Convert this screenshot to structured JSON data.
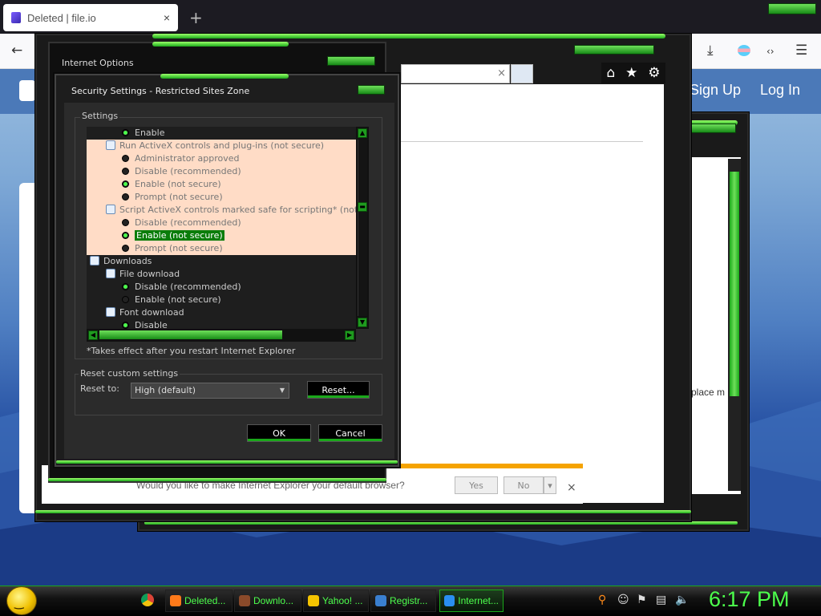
{
  "browser": {
    "tab_title": "Deleted | file.io",
    "new_tab_icon": "+",
    "close_tab_icon": "×"
  },
  "site": {
    "signup": "Sign Up",
    "login": "Log In",
    "partial_text": "place m"
  },
  "ie": {
    "notification": "Would you like to make Internet Explorer your default browser?",
    "yes": "Yes",
    "no": "No"
  },
  "internet_options": {
    "title": "Internet Options"
  },
  "security": {
    "title": "Security Settings - Restricted Sites Zone",
    "settings_label": "Settings",
    "tree": [
      {
        "text": "Enable",
        "type": "radio",
        "on": true,
        "indent": 2,
        "hl": false
      },
      {
        "text": "Run ActiveX controls and plug-ins (not secure)",
        "type": "group",
        "indent": 1,
        "hl": true
      },
      {
        "text": "Administrator approved",
        "type": "radio",
        "on": false,
        "indent": 2,
        "hl": true
      },
      {
        "text": "Disable (recommended)",
        "type": "radio",
        "on": false,
        "indent": 2,
        "hl": true
      },
      {
        "text": "Enable (not secure)",
        "type": "radio",
        "on": true,
        "indent": 2,
        "hl": true
      },
      {
        "text": "Prompt (not secure)",
        "type": "radio",
        "on": false,
        "indent": 2,
        "hl": true
      },
      {
        "text": "Script ActiveX controls marked safe for scripting* (not secure)",
        "type": "group",
        "indent": 1,
        "hl": true
      },
      {
        "text": "Disable (recommended)",
        "type": "radio",
        "on": false,
        "indent": 2,
        "hl": true
      },
      {
        "text": "Enable (not secure)",
        "type": "radio",
        "on": true,
        "indent": 2,
        "hl": true,
        "sel": true
      },
      {
        "text": "Prompt (not secure)",
        "type": "radio",
        "on": false,
        "indent": 2,
        "hl": true
      },
      {
        "text": "Downloads",
        "type": "category",
        "indent": 0,
        "hl": false
      },
      {
        "text": "File download",
        "type": "group",
        "indent": 1,
        "hl": false
      },
      {
        "text": "Disable (recommended)",
        "type": "radio",
        "on": true,
        "indent": 2,
        "hl": false
      },
      {
        "text": "Enable (not secure)",
        "type": "radio",
        "on": false,
        "indent": 2,
        "hl": false
      },
      {
        "text": "Font download",
        "type": "group",
        "indent": 1,
        "hl": false
      },
      {
        "text": "Disable",
        "type": "radio",
        "on": true,
        "indent": 2,
        "hl": false
      }
    ],
    "note": "*Takes effect after you restart Internet Explorer",
    "reset_group_label": "Reset custom settings",
    "reset_to_label": "Reset to:",
    "reset_to_value": "High (default)",
    "reset_button": "Reset...",
    "ok": "OK",
    "cancel": "Cancel"
  },
  "taskbar": {
    "items": [
      {
        "label": "Deleted...",
        "icon": "firefox-icon",
        "color": "#ff7a1a"
      },
      {
        "label": "Downlo...",
        "icon": "downloads-folder-icon",
        "color": "#8a4a2a"
      },
      {
        "label": "Yahoo! ...",
        "icon": "yahoo-smiley-icon",
        "color": "#f5c400"
      },
      {
        "label": "Registr...",
        "icon": "registry-editor-icon",
        "color": "#3a7fd0"
      },
      {
        "label": "Internet...",
        "icon": "internet-explorer-icon",
        "color": "#2a8ef0"
      }
    ],
    "clock": "6:17 PM"
  }
}
